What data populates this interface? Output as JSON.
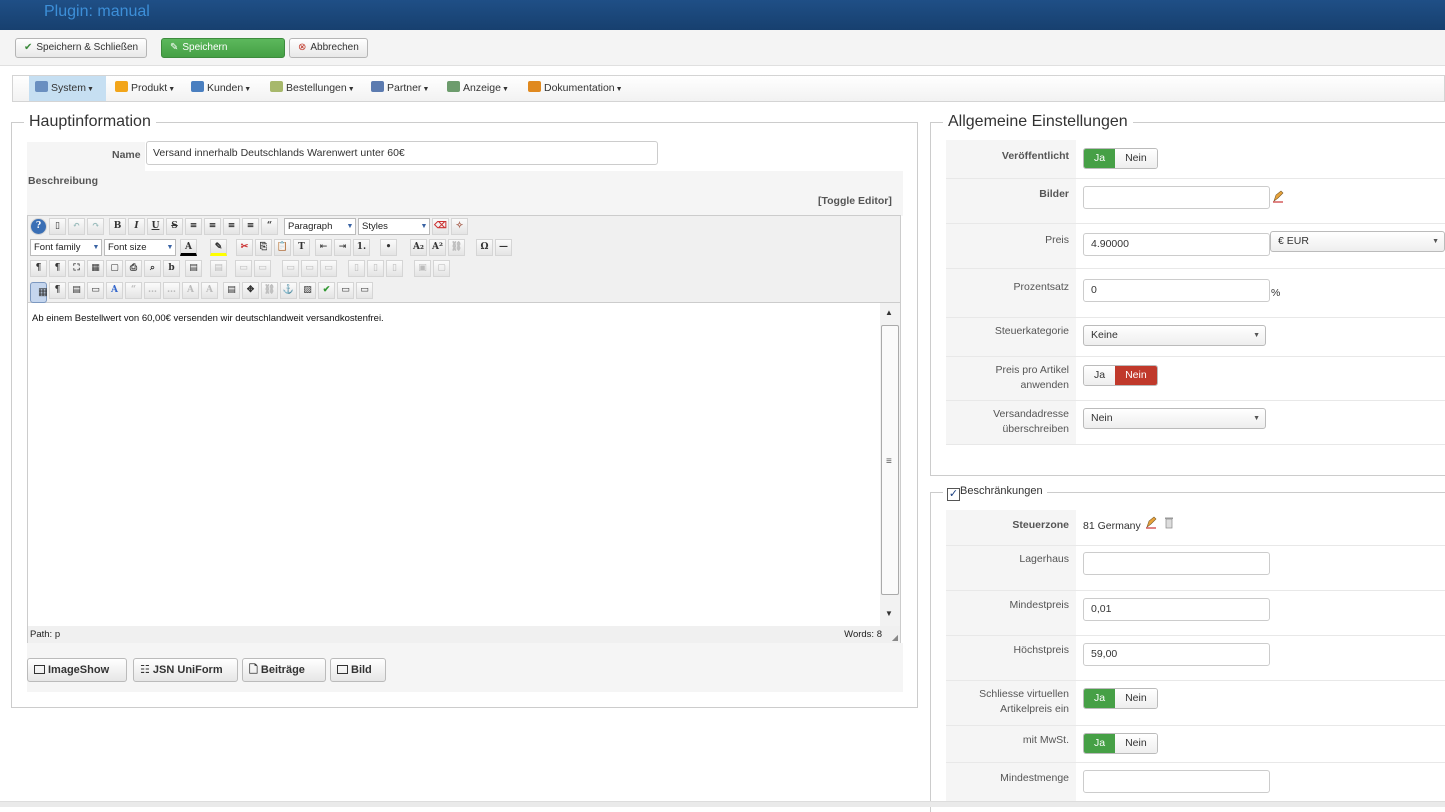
{
  "header": {
    "title": "Plugin: manual"
  },
  "toolbar": {
    "save_close": "Speichern & Schließen",
    "save": "Speichern",
    "cancel": "Abbrechen"
  },
  "menu": [
    "System",
    "Produkt",
    "Kunden",
    "Bestellungen",
    "Partner",
    "Anzeige",
    "Dokumentation"
  ],
  "main": {
    "legend": "Hauptinformation",
    "name_label": "Name",
    "name_value": "Versand innerhalb Deutschlands Warenwert unter 60€",
    "desc_label": "Beschreibung",
    "toggle_editor": "[Toggle Editor]",
    "editor": {
      "format_value": "Paragraph",
      "styles_value": "Styles",
      "font_family": "Font family",
      "font_size": "Font size",
      "content": "Ab einem Bestellwert von 60,00€ versenden wir deutschlandweit versandkostenfrei.",
      "path": "Path: p",
      "words": "Words: 8"
    },
    "buttons": {
      "imageshow": "ImageShow",
      "json": "JSN UniForm",
      "beitraege": "Beiträge",
      "bild": "Bild"
    }
  },
  "general": {
    "legend": "Allgemeine Einstellungen",
    "published_label": "Veröffentlicht",
    "yes": "Ja",
    "no": "Nein",
    "images_label": "Bilder",
    "price_label": "Preis",
    "price_value": "4.90000",
    "currency_value": "€ EUR",
    "percent_label": "Prozentsatz",
    "percent_value": "0",
    "percent_sign": "%",
    "tax_label": "Steuerkategorie",
    "tax_value": "Keine",
    "per_item_label": "Preis pro Artikel anwenden",
    "override_label": "Versandadresse überschreiben",
    "override_value": "Nein"
  },
  "restrictions": {
    "legend": "Beschränkungen",
    "zone_label": "Steuerzone",
    "zone_value": "81 Germany",
    "warehouse_label": "Lagerhaus",
    "min_price_label": "Mindestpreis",
    "min_price_value": "0,01",
    "max_price_label": "Höchstpreis",
    "max_price_value": "59,00",
    "virtual_label": "Schliesse virtuellen Artikelpreis ein",
    "vat_label": "mit MwSt.",
    "min_qty_label": "Mindestmenge"
  },
  "colors": {
    "header": "#1a4a7f",
    "green": "#46a046",
    "red": "#c0392b"
  }
}
